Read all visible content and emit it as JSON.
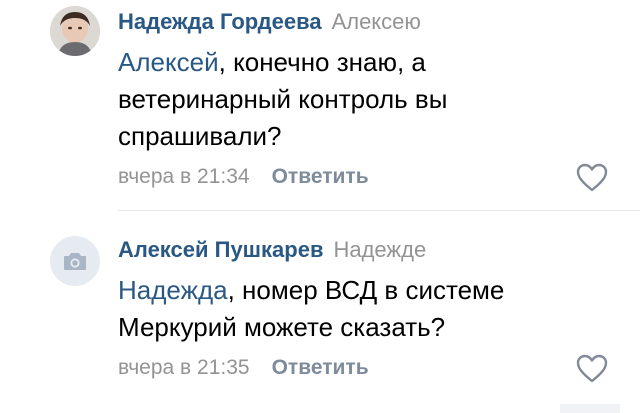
{
  "colors": {
    "author": "#2a5885",
    "secondary": "#939393",
    "reply_action": "#7d8b9a",
    "body": "#000000"
  },
  "comments": [
    {
      "author": "Надежда Гордеева",
      "reply_to": "Алексею",
      "mention": "Алексей",
      "text": ", конечно знаю, а ветеринарный контроль вы спрашивали?",
      "time": "вчера в 21:34",
      "reply_label": "Ответить",
      "avatar_icon": "user-photo",
      "like_icon": "heart-outline-icon"
    },
    {
      "author": "Алексей Пушкарев",
      "reply_to": "Надежде",
      "mention": "Надежда",
      "text": ", номер ВСД в системе Меркурий можете сказать?",
      "time": "вчера в 21:35",
      "reply_label": "Ответить",
      "avatar_icon": "camera-icon",
      "like_icon": "heart-outline-icon"
    }
  ]
}
